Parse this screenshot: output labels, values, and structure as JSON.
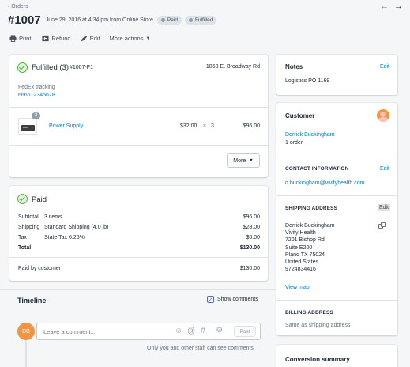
{
  "breadcrumb": {
    "back_label": "Orders"
  },
  "header": {
    "order_number": "#1007",
    "meta": "June 29, 2016 at 4:34 pm from Online Store",
    "payment_badge": "Paid",
    "fulfillment_badge": "Fulfilled"
  },
  "actions": {
    "print": "Print",
    "refund": "Refund",
    "edit": "Edit",
    "more": "More actions"
  },
  "fulfilled": {
    "title": "Fulfilled (3)",
    "fulfillment_id": "#1007-F1",
    "location": "1868 E. Broadway Rd",
    "tracking_label": "FedEx tracking",
    "tracking_number": "666612345678",
    "item": {
      "name": "Power Supply",
      "quantity_badge": "3",
      "price": "$32.00",
      "times": "×",
      "qty": "3",
      "total": "$96.00"
    },
    "more_button": "More"
  },
  "paid": {
    "title": "Paid",
    "rows": [
      {
        "label": "Subtotal",
        "desc": "3 items",
        "amount": "$96.00"
      },
      {
        "label": "Shipping",
        "desc": "Standard Shipping (4.0 lb)",
        "amount": "$28.00"
      },
      {
        "label": "Tax",
        "desc": "State Tax 6.25%",
        "amount": "$6.00"
      }
    ],
    "total_label": "Total",
    "total_amount": "$130.00",
    "paid_by_label": "Paid by customer",
    "paid_by_amount": "$130.00"
  },
  "timeline": {
    "title": "Timeline",
    "show_comments": "Show comments",
    "avatar_initials": "DB",
    "comment_placeholder": "Leave a comment...",
    "post_button": "Post",
    "note": "Only you and other staff can see comments"
  },
  "notes": {
    "title": "Notes",
    "edit": "Edit",
    "text": "Logistics PO 1169"
  },
  "customer": {
    "title": "Customer",
    "name": "Derrick Buckingham",
    "orders": "1 order",
    "contact_title": "CONTACT INFORMATION",
    "contact_edit": "Edit",
    "email": "d.buckingham@vivifyhealth.com",
    "shipping_title": "SHIPPING ADDRESS",
    "shipping_edit": "Edit",
    "address_lines": [
      "Derrick Buckingham",
      "Vivify Health",
      "7201 Bishop Rd",
      "Suite E200",
      "Plano TX 75024",
      "United States",
      "9724834416"
    ],
    "view_map": "View map",
    "billing_title": "BILLING ADDRESS",
    "billing_text": "Same as shipping address"
  },
  "conversion": {
    "title": "Conversion summary"
  },
  "colors": {
    "accent": "#007ace",
    "success": "#50b83c",
    "avatar": "#f49342"
  }
}
